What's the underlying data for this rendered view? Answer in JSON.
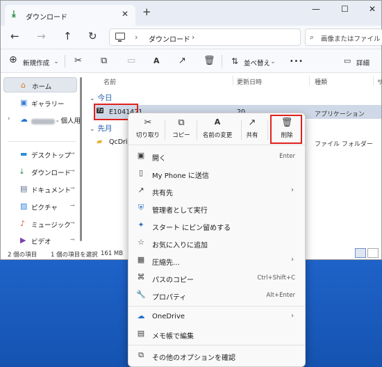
{
  "window": {
    "tab_title": "ダウンロード",
    "new_tab": "+",
    "tab_close": "✕",
    "controls": [
      "—",
      "☐",
      "✕"
    ]
  },
  "nav": {
    "back": "←",
    "forward": "→",
    "up": "↑",
    "refresh": "↻",
    "breadcrumb_sep": "›",
    "address": "ダウンロード",
    "search_placeholder": "画像またはファイル"
  },
  "toolbar": {
    "new_label": "新規作成",
    "sort_label": "並べ替え",
    "more": "•••",
    "details_label": "詳細"
  },
  "sidebar": {
    "items": [
      {
        "label": "ホーム",
        "icon": "⌂",
        "color": "#d0781c"
      },
      {
        "label": "ギャラリー",
        "icon": "▣",
        "color": "#3a7bd5"
      },
      {
        "label": "- 個人用",
        "icon": "☁",
        "color": "#1f74d1"
      },
      {
        "label": "デスクトップ",
        "icon": "▬",
        "color": "#2a8fd6"
      },
      {
        "label": "ダウンロード",
        "icon": "⤓",
        "color": "#1a8a3f"
      },
      {
        "label": "ドキュメント",
        "icon": "▤",
        "color": "#5a6e8a"
      },
      {
        "label": "ピクチャ",
        "icon": "▨",
        "color": "#2e86de"
      },
      {
        "label": "ミュージック",
        "icon": "♪",
        "color": "#d9542b"
      },
      {
        "label": "ビデオ",
        "icon": "▶",
        "color": "#7b3fb8"
      }
    ],
    "pin": "📌"
  },
  "files": {
    "columns": [
      "名前",
      "更新日時",
      "種類",
      "サ"
    ],
    "groups": [
      {
        "label": "今日",
        "items": [
          {
            "name": "E1041421",
            "modified": "20",
            "type": "アプリケーション"
          }
        ]
      },
      {
        "label": "先月",
        "items": [
          {
            "name": "QcDrive",
            "type": "ファイル フォルダー"
          }
        ]
      }
    ]
  },
  "status": {
    "item_count": "2 個の項目",
    "selection": "1 個の項目を選択",
    "size": "161 MB"
  },
  "context_menu": {
    "quick_actions": [
      {
        "label": "切り取り",
        "icon": "✂"
      },
      {
        "label": "コピー",
        "icon": "⧉"
      },
      {
        "label": "名前の変更",
        "icon": "A"
      },
      {
        "label": "共有",
        "icon": "↗"
      },
      {
        "label": "削除",
        "icon": "🗑"
      }
    ],
    "items": [
      {
        "label": "開く",
        "shortcut": "Enter",
        "icon": "▣"
      },
      {
        "label": "My Phone に送信",
        "icon": "▯"
      },
      {
        "label": "共有先",
        "icon": "↗",
        "arrow": "›"
      },
      {
        "label": "管理者として実行",
        "icon": "⛨"
      },
      {
        "label": "スタート にピン留めする",
        "icon": "✦"
      },
      {
        "label": "お気に入りに追加",
        "icon": "☆"
      },
      {
        "label": "圧縮先...",
        "icon": "▦",
        "arrow": "›"
      },
      {
        "label": "パスのコピー",
        "shortcut": "Ctrl+Shift+C",
        "icon": "⌘"
      },
      {
        "label": "プロパティ",
        "shortcut": "Alt+Enter",
        "icon": "🔧"
      },
      {
        "label": "OneDrive",
        "icon": "☁",
        "arrow": "›"
      },
      {
        "label": "メモ帳で編集",
        "icon": "▤"
      },
      {
        "label": "その他のオプションを確認",
        "icon": "⧉"
      }
    ]
  },
  "colors": {
    "highlight": "#e0201d",
    "accent": "#1e5aa8",
    "desktop": "#1f63c9"
  }
}
